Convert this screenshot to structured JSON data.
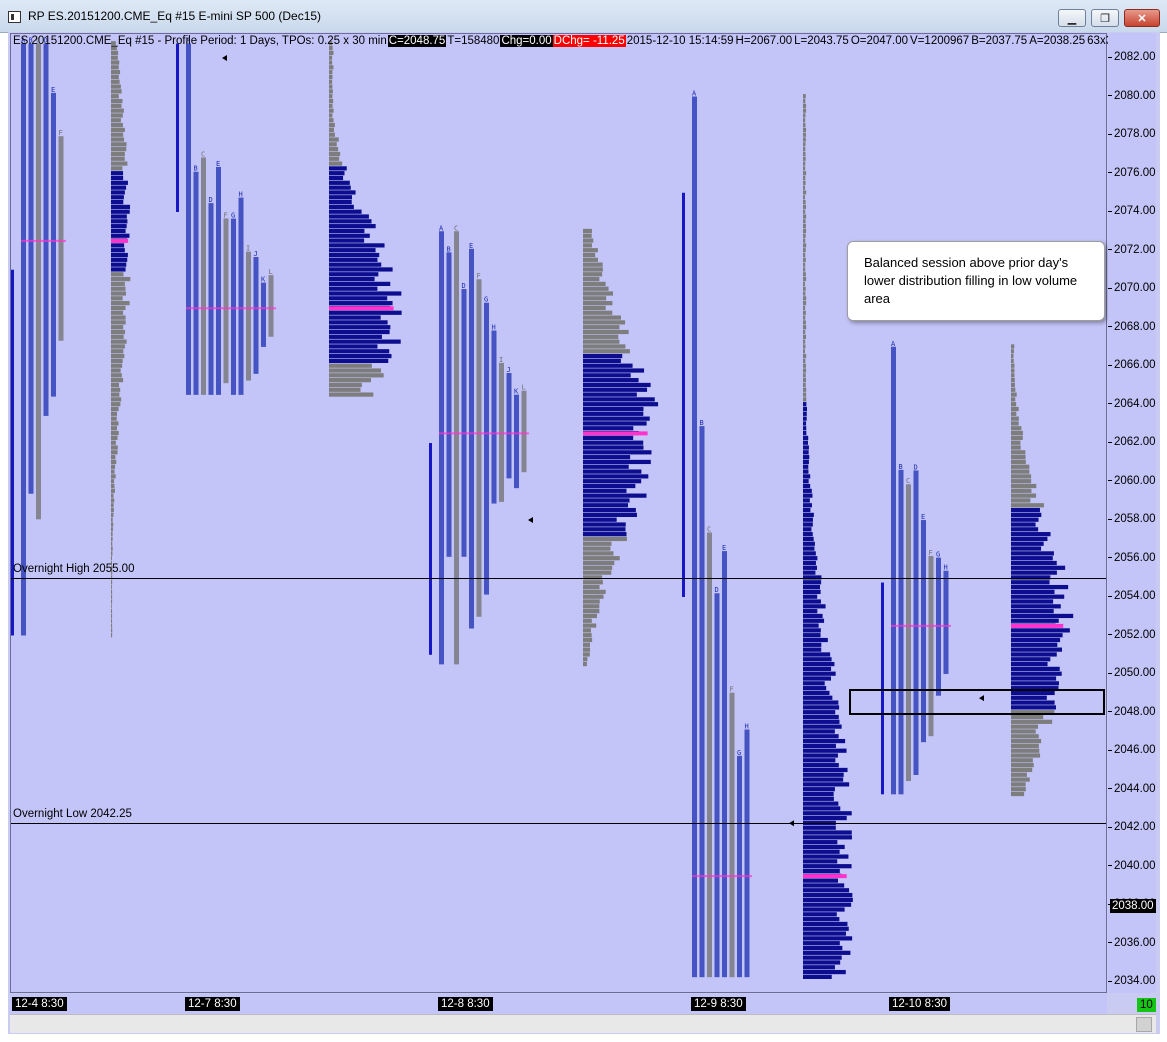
{
  "window": {
    "title": "RP  ES.20151200.CME_Eq  #15  E-mini SP 500 (Dec15)",
    "controls": {
      "minimize": "▁",
      "maximize": "❐",
      "close": "✕"
    }
  },
  "infobar": {
    "symbol": "ES.20151200.CME_Eq  #15 - Profile Period: 1 Days, TPOs: 0.25 x 30 min",
    "close": "C=2048.75",
    "ticks": "T=158480",
    "change": "Chg=0.00",
    "dchange": "DChg= -11.25",
    "timestamp": "2015-12-10 15:14:59",
    "high": "H=2067.00",
    "low": "L=2043.75",
    "open": "O=2047.00",
    "volume": "V=1200967",
    "bid": "B=2037.75",
    "ask": "A=2038.25",
    "extra": "63x3"
  },
  "price_axis": {
    "ticks": [
      "2082.00",
      "2080.00",
      "2078.00",
      "2076.00",
      "2074.00",
      "2072.00",
      "2070.00",
      "2068.00",
      "2066.00",
      "2064.00",
      "2062.00",
      "2060.00",
      "2058.00",
      "2056.00",
      "2054.00",
      "2052.00",
      "2050.00",
      "2048.00",
      "2046.00",
      "2044.00",
      "2042.00",
      "2040.00",
      "2038.00",
      "2036.00",
      "2034.00"
    ],
    "current_price": "2038.00"
  },
  "time_axis": {
    "dates": [
      "12-4  8:30",
      "12-7  8:30",
      "12-8  8:30",
      "12-9  8:30",
      "12-10  8:30"
    ],
    "bar_count": "10"
  },
  "levels": [
    {
      "label": "Overnight High  2055.00",
      "price": 2055.0
    },
    {
      "label": "Overnight Low  2042.25",
      "price": 2042.25
    }
  ],
  "annotation": {
    "text": "Balanced session above prior day's lower distribution filling in low volume area"
  },
  "colors": {
    "background": "#c3c4f7",
    "volume_value_area": "#0c0e8f",
    "volume_outside": "#7d7d7d",
    "poc": "#ff33cc",
    "tpo_letters": "#1c2eb0",
    "tpo_gray": "#707070",
    "range_bar": "#1717c8",
    "dchg_red": "#ff0000",
    "bars_badge": "#16c416"
  },
  "chart_data": {
    "type": "market-profile",
    "y_range": [
      2033.5,
      2083.0
    ],
    "tick_size": 0.25,
    "sessions": [
      {
        "date": "12-4",
        "tpo_high": 2082.75,
        "tpo_low": 2052.0,
        "range_bar": [
          2052.0,
          2071.0
        ],
        "vol_high": 2082.75,
        "vol_low": 2052.0,
        "va_high": 2076.0,
        "va_low": 2071.0,
        "poc": 2072.5
      },
      {
        "date": "12-7",
        "tpo_high": 2082.75,
        "tpo_low": 2064.5,
        "range_bar": [
          2074.0,
          2082.75
        ],
        "vol_high": 2082.75,
        "vol_low": 2064.5,
        "va_high": 2076.25,
        "va_low": 2066.25,
        "poc": 2069.0
      },
      {
        "date": "12-8",
        "tpo_high": 2073.0,
        "tpo_low": 2050.5,
        "range_bar": [
          2051.0,
          2062.0
        ],
        "vol_high": 2073.0,
        "vol_low": 2050.5,
        "va_high": 2066.5,
        "va_low": 2057.25,
        "poc": 2062.5
      },
      {
        "date": "12-9",
        "tpo_high": 2080.0,
        "tpo_low": 2034.25,
        "range_bar": [
          2054.0,
          2075.0
        ],
        "vol_high": 2080.0,
        "vol_low": 2034.25,
        "va_high": 2064.0,
        "va_low": 2034.25,
        "poc": 2039.5
      },
      {
        "date": "12-10",
        "tpo_high": 2067.0,
        "tpo_low": 2043.75,
        "range_bar": [
          2043.75,
          2054.75
        ],
        "vol_high": 2067.0,
        "vol_low": 2043.75,
        "va_high": 2058.5,
        "va_low": 2048.25,
        "poc": 2052.5
      }
    ]
  }
}
